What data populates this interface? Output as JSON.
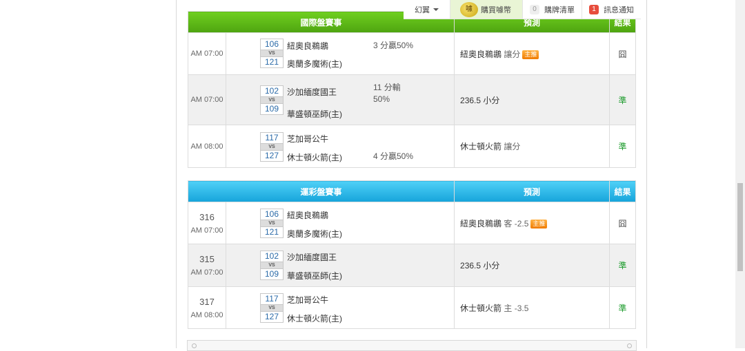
{
  "nav": {
    "fantasy_label": "幻翼",
    "coin_label": "購買噱幣",
    "coin_icon_text": "噱",
    "cart_count": "0",
    "cart_label": "購牌清單",
    "notify_count": "1",
    "notify_label": "訊息通知"
  },
  "section1": {
    "headers": {
      "matches": "國際盤賽事",
      "predict": "預測",
      "result": "結果"
    },
    "rows": [
      {
        "time": "AM 07:00",
        "away_score": "106",
        "home_score": "121",
        "away_team": "紐奧良鵜鶘",
        "home_team": "奧蘭多魔術(主)",
        "line_top": "3 分贏50%",
        "line_bottom": "",
        "pred_main": "紐奧良鵜鶘",
        "pred_sub": " 讓分",
        "badge": "主推",
        "result": "囧"
      },
      {
        "time": "AM 07:00",
        "away_score": "102",
        "home_score": "109",
        "away_team": "沙加緬度國王",
        "home_team": "華盛頓巫師(主)",
        "line_top": "11 分輸\n50%",
        "line_bottom": "",
        "pred_main": "236.5 小分",
        "pred_sub": "",
        "badge": "",
        "result": "準"
      },
      {
        "time": "AM 08:00",
        "away_score": "117",
        "home_score": "127",
        "away_team": "芝加哥公牛",
        "home_team": "休士頓火箭(主)",
        "line_top": "",
        "line_bottom": "4 分贏50%",
        "pred_main": "休士頓火箭",
        "pred_sub": " 讓分",
        "badge": "",
        "result": "準"
      }
    ]
  },
  "section2": {
    "headers": {
      "matches": "運彩盤賽事",
      "predict": "預測",
      "result": "結果"
    },
    "rows": [
      {
        "game_no": "316",
        "time": "AM 07:00",
        "away_score": "106",
        "home_score": "121",
        "away_team": "紐奧良鵜鶘",
        "home_team": "奧蘭多魔術(主)",
        "pred_main": "紐奧良鵜鶘",
        "pred_sub": " 客 -2.5",
        "badge": "主推",
        "result": "囧"
      },
      {
        "game_no": "315",
        "time": "AM 07:00",
        "away_score": "102",
        "home_score": "109",
        "away_team": "沙加緬度國王",
        "home_team": "華盛頓巫師(主)",
        "pred_main": "236.5 小分",
        "pred_sub": "",
        "badge": "",
        "result": "準"
      },
      {
        "game_no": "317",
        "time": "AM 08:00",
        "away_score": "117",
        "home_score": "127",
        "away_team": "芝加哥公牛",
        "home_team": "休士頓火箭(主)",
        "pred_main": "休士頓火箭",
        "pred_sub": " 主 -3.5",
        "badge": "",
        "result": "準"
      }
    ]
  },
  "vs_text": "VS",
  "colors": {
    "green_header": "#5bb817",
    "blue_header": "#29b6e8",
    "win": "#1a9a2a",
    "badge": "#f08a10"
  }
}
